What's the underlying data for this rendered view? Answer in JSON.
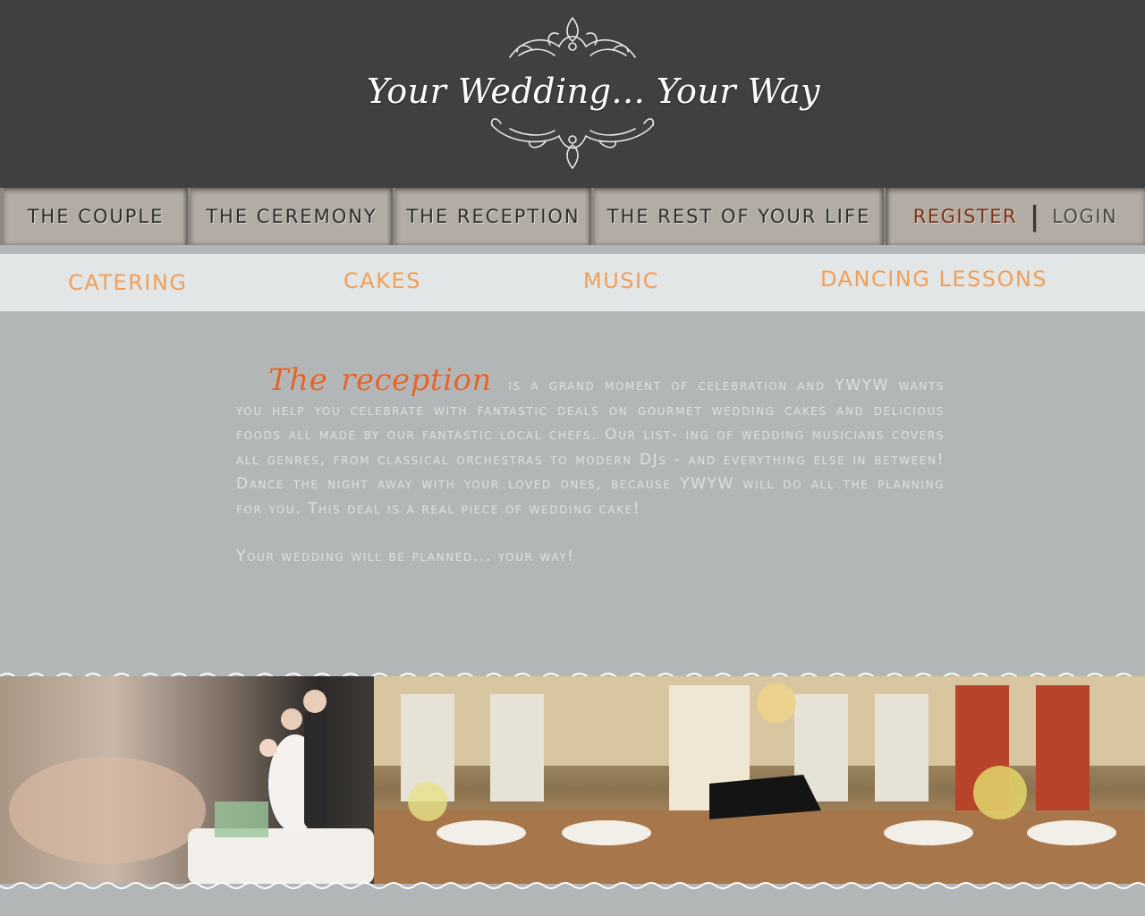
{
  "header": {
    "logo_text": "Your Wedding... Your Way",
    "background": "#3f4140"
  },
  "main_nav": {
    "items": [
      {
        "label": "THE COUPLE"
      },
      {
        "label": "THE CEREMONY"
      },
      {
        "label": "THE RECEPTION"
      },
      {
        "label": "THE REST OF YOUR LIFE"
      }
    ],
    "register": "REGISTER",
    "separator": "|",
    "login": "LOGIN"
  },
  "sub_nav": {
    "items": [
      {
        "label": "CATERING"
      },
      {
        "label": "CAKES"
      },
      {
        "label": "MUSIC"
      },
      {
        "label": "DANCING LESSONS"
      }
    ],
    "color": "#f0a05a"
  },
  "content": {
    "lead": "The reception",
    "body": "is a grand moment of celebration and YWYW wants you help you celebrate with fantastic deals on gourmet wedding cakes and delicious foods all made by our fantastic local chefs. Our list- ing of wedding musicians covers all genres, from classical orchestras to modern DJs - and everything else in between! Dance the night away with your loved ones, because YWYW will do all the planning for you. This deal is a real piece of wedding cake!",
    "closing": "Your wedding will be planned... your way!",
    "lead_color": "#e2652a"
  },
  "photos": [
    {
      "icon": "cake-cutting-photo"
    },
    {
      "icon": "reception-hall-photo"
    }
  ]
}
